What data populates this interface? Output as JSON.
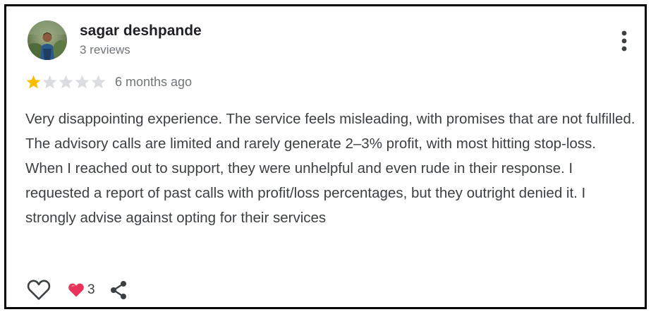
{
  "review": {
    "author_name": "sagar deshpande",
    "review_count": "3 reviews",
    "rating": 1,
    "max_rating": 5,
    "time_ago": "6 months ago",
    "text": "Very disappointing experience. The service feels misleading, with promises that are not fulfilled. The advisory calls are limited and rarely generate 2–3% profit, with most hitting stop-loss. When I reached out to support, they were unhelpful and even rude in their response. I requested a report of past calls with profit/loss percentages, but they outright denied it. I strongly advise against opting for their services"
  },
  "actions": {
    "reaction_count": "3"
  },
  "icons": {
    "avatar": "avatar-photo",
    "menu": "more-vert-icon",
    "star_filled": "star-filled-icon",
    "star_empty": "star-empty-icon",
    "like": "heart-outline-icon",
    "reaction": "heart-filled-icon",
    "share": "share-icon"
  },
  "colors": {
    "star_filled": "#fbbc04",
    "star_empty": "#dadce0",
    "reaction_heart": "#e8345a",
    "secondary_text": "#70757a",
    "body_text": "#3c4043",
    "card_border": "#000000"
  }
}
